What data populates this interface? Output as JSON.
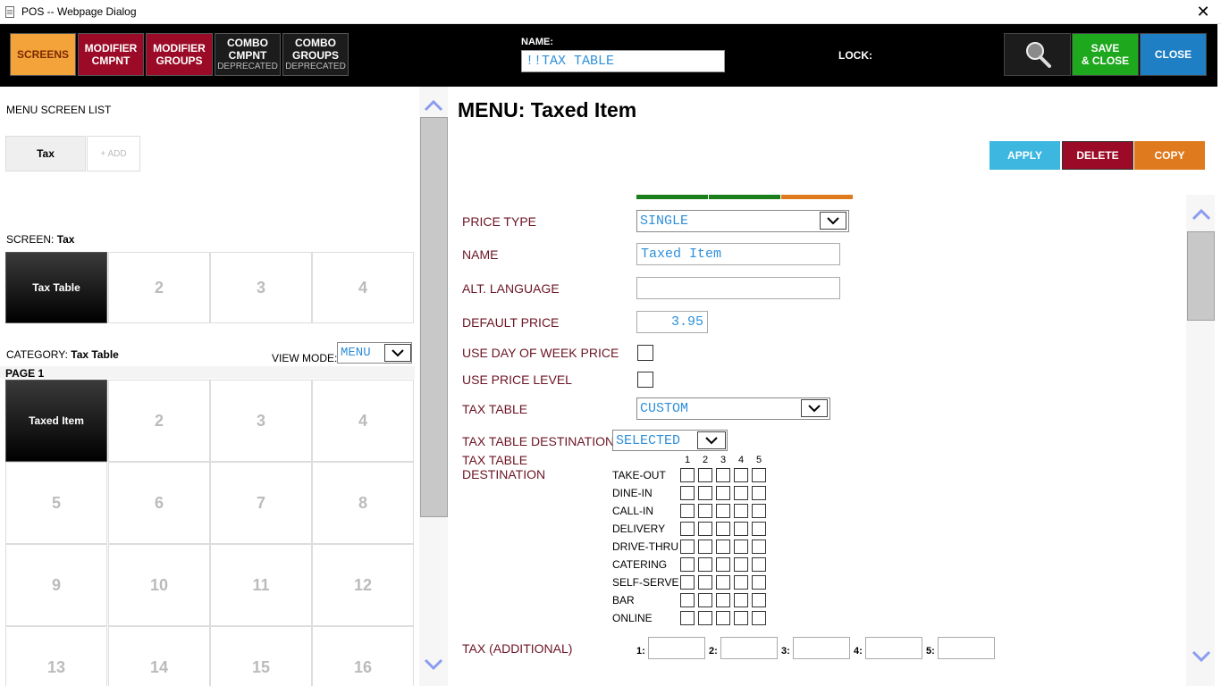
{
  "window": {
    "title": "POS -- Webpage Dialog"
  },
  "toolbar": {
    "screens": "SCREENS",
    "modifier_cmpnt": [
      "MODIFIER",
      "CMPNT"
    ],
    "modifier_groups": [
      "MODIFIER",
      "GROUPS"
    ],
    "combo_cmpnt": [
      "COMBO",
      "CMPNT",
      "DEPRECATED"
    ],
    "combo_groups": [
      "COMBO",
      "GROUPS",
      "DEPRECATED"
    ],
    "name_label": "NAME:",
    "name_value": "!!TAX TABLE",
    "lock_label": "LOCK:",
    "save_close": [
      "SAVE",
      "& CLOSE"
    ],
    "close": "CLOSE",
    "colors": {
      "screens": "#f4a23a",
      "modifier": "#9b0a26",
      "combo": "#1c1c1c",
      "save": "#1ea81e",
      "close": "#1f7fc4"
    }
  },
  "left": {
    "menu_screen_list_label": "MENU SCREEN LIST",
    "tab_tax": "Tax",
    "tab_add": "+ ADD",
    "screen_label": "SCREEN:",
    "screen_value": "Tax",
    "screen_cells": [
      "Tax Table",
      "2",
      "3",
      "4"
    ],
    "category_label": "CATEGORY:",
    "category_value": "Tax Table",
    "view_mode_label": "VIEW MODE:",
    "view_mode_value": "MENU",
    "page_label": "PAGE 1",
    "item_cells": [
      "Taxed Item",
      "2",
      "3",
      "4",
      "5",
      "6",
      "7",
      "8",
      "9",
      "10",
      "11",
      "12",
      "13",
      "14",
      "15",
      "16"
    ]
  },
  "right": {
    "title": "MENU: Taxed Item",
    "apply": "APPLY",
    "delete": "DELETE",
    "copy": "COPY",
    "colors": {
      "apply": "#3db6e0",
      "delete": "#9b0a26",
      "copy": "#e07a1e",
      "bar_green": "#1a7f1a",
      "bar_orange": "#e07a1e"
    },
    "price_type_label": "PRICE TYPE",
    "price_type_value": "SINGLE",
    "name_label": "NAME",
    "name_value": "Taxed Item",
    "alt_language_label": "ALT. LANGUAGE",
    "alt_language_value": "",
    "default_price_label": "DEFAULT PRICE",
    "default_price_value": "3.95",
    "use_dow_label": "USE DAY OF WEEK PRICE",
    "use_price_level_label": "USE PRICE LEVEL",
    "tax_table_label": "TAX TABLE",
    "tax_table_value": "CUSTOM",
    "tax_dest_label": "TAX TABLE DESTINATION",
    "tax_dest_value": "SELECTED",
    "tax_dest_grid_label": [
      "TAX TABLE",
      "DESTINATION"
    ],
    "dest_columns": [
      "1",
      "2",
      "3",
      "4",
      "5"
    ],
    "dest_rows": [
      "TAKE-OUT",
      "DINE-IN",
      "CALL-IN",
      "DELIVERY",
      "DRIVE-THRU",
      "CATERING",
      "SELF-SERVE",
      "BAR",
      "ONLINE"
    ],
    "tax_additional_label": "TAX (ADDITIONAL)",
    "tax_additional_slots": [
      "1:",
      "2:",
      "3:",
      "4:",
      "5:"
    ]
  }
}
